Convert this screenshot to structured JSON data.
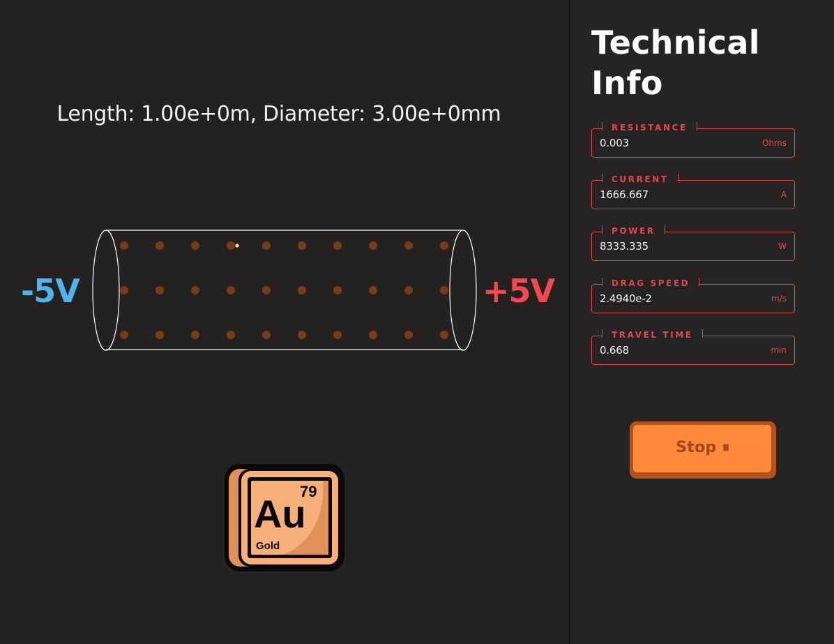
{
  "simulation": {
    "dimensions_text": "Length: 1.00e+0m, Diameter: 3.00e+0mm",
    "voltage_negative": "-5V",
    "voltage_positive": "+5V",
    "colors": {
      "negative": "#4fb3ec",
      "positive": "#f4474f",
      "electron": "#7a3c18",
      "highlight_electron": "#ffe066"
    },
    "element": {
      "symbol": "Au",
      "atomic_number": "79",
      "name": "Gold"
    }
  },
  "panel": {
    "title": "Technical Info",
    "fields": [
      {
        "label": "RESISTANCE",
        "value": "0.003",
        "unit": "Ohms"
      },
      {
        "label": "CURRENT",
        "value": "1666.667",
        "unit": "A"
      },
      {
        "label": "POWER",
        "value": "8333.335",
        "unit": "W"
      },
      {
        "label": "DRAG SPEED",
        "value": "2.4940e-2",
        "unit": "m/s"
      },
      {
        "label": "TRAVEL TIME",
        "value": "0.668",
        "unit": "min"
      }
    ],
    "stop_button_label": "Stop ⏸"
  }
}
